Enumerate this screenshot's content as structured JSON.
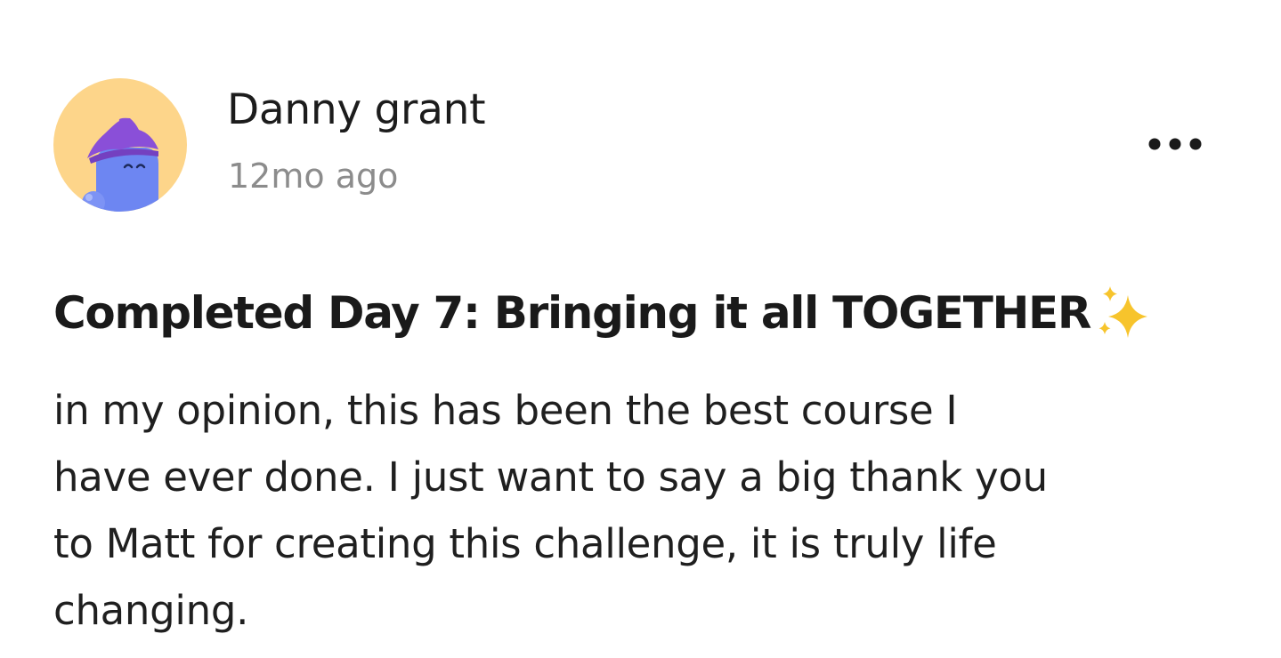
{
  "post": {
    "author": {
      "name": "Danny grant",
      "avatar": "wizard-avatar-icon"
    },
    "timestamp": "12mo ago",
    "menu_icon": "more-options-icon",
    "title": "Completed Day 7: Bringing it all TOGETHER",
    "title_emoji": "sparkles-icon",
    "body_lines": [
      " in my opinion, this has been the best course I",
      "have ever done. I just want to say a big thank you",
      "to Matt for creating this challenge, it is truly life",
      "changing."
    ]
  },
  "colors": {
    "avatar_bg": "#fdd58a",
    "avatar_body": "#6d86f2",
    "avatar_hat": "#8a4fd8",
    "sparkle": "#f7c42c",
    "text_primary": "#1a1a1a",
    "text_secondary": "#8c8c8c"
  }
}
